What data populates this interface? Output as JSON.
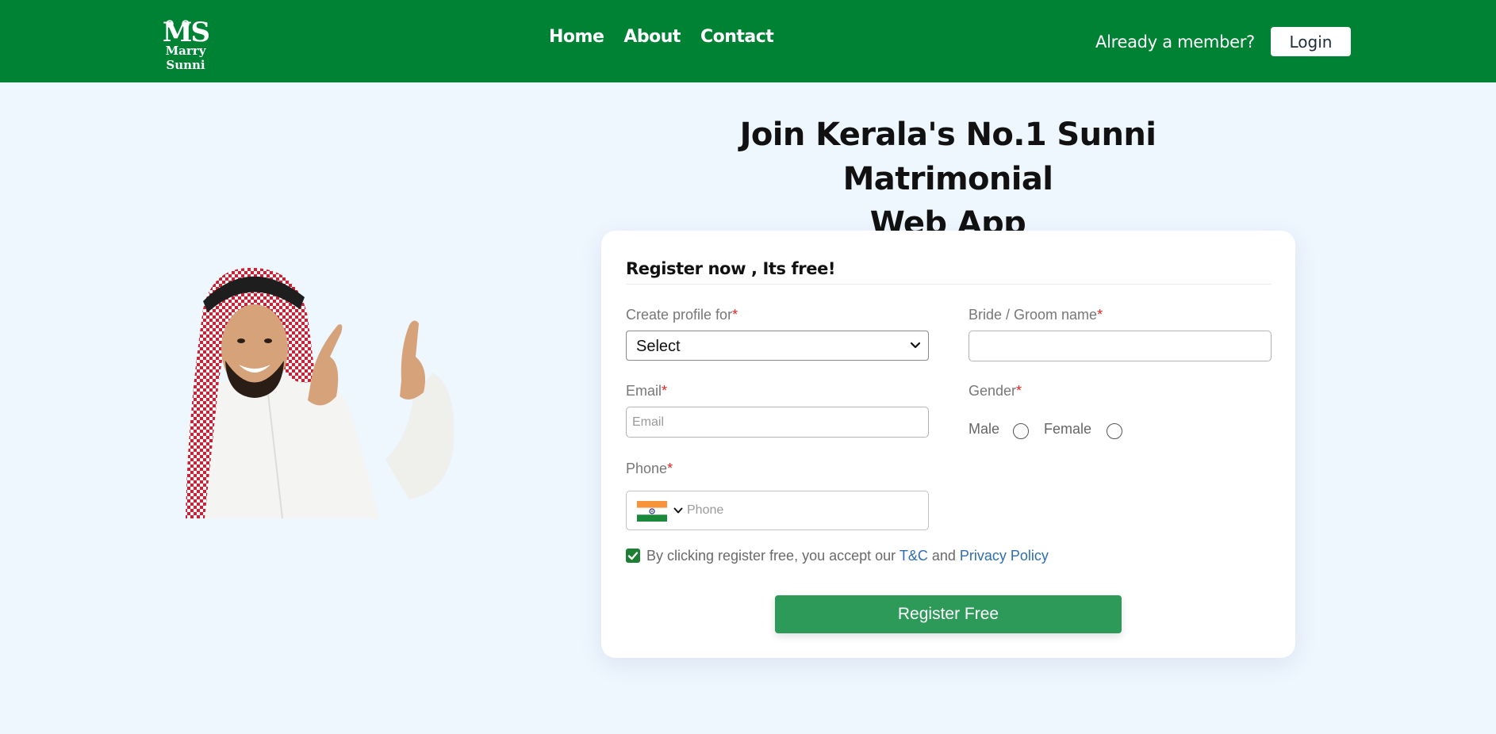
{
  "header": {
    "logo_mark": "MS",
    "logo_text": "Marry Sunni",
    "nav": [
      "Home",
      "About",
      "Contact"
    ],
    "member_text": "Already a member?",
    "login_label": "Login"
  },
  "hero": {
    "title_line1": "Join Kerala's No.1 Sunni Matrimonial",
    "title_line2": "Web App"
  },
  "form": {
    "title": "Register now , Its free!",
    "profile_for_label": "Create profile for",
    "profile_for_value": "Select",
    "name_label": "Bride / Groom name",
    "name_value": "",
    "email_label": "Email",
    "email_placeholder": "Email",
    "gender_label": "Gender",
    "gender_options": [
      "Male",
      "Female"
    ],
    "phone_label": "Phone",
    "phone_placeholder": "Phone",
    "phone_country_icon": "india-flag-icon",
    "required_marker": "*",
    "terms_prefix": "By clicking register free, you accept our",
    "terms_link": "T&C",
    "terms_and": "and",
    "privacy_link": "Privacy Policy",
    "terms_checked": true,
    "submit_label": "Register Free"
  },
  "colors": {
    "header_bg": "#008234",
    "page_bg": "#eef6fe",
    "button_green": "#2e9a5a",
    "link_blue": "#2e6db4",
    "required_red": "#e02424"
  }
}
